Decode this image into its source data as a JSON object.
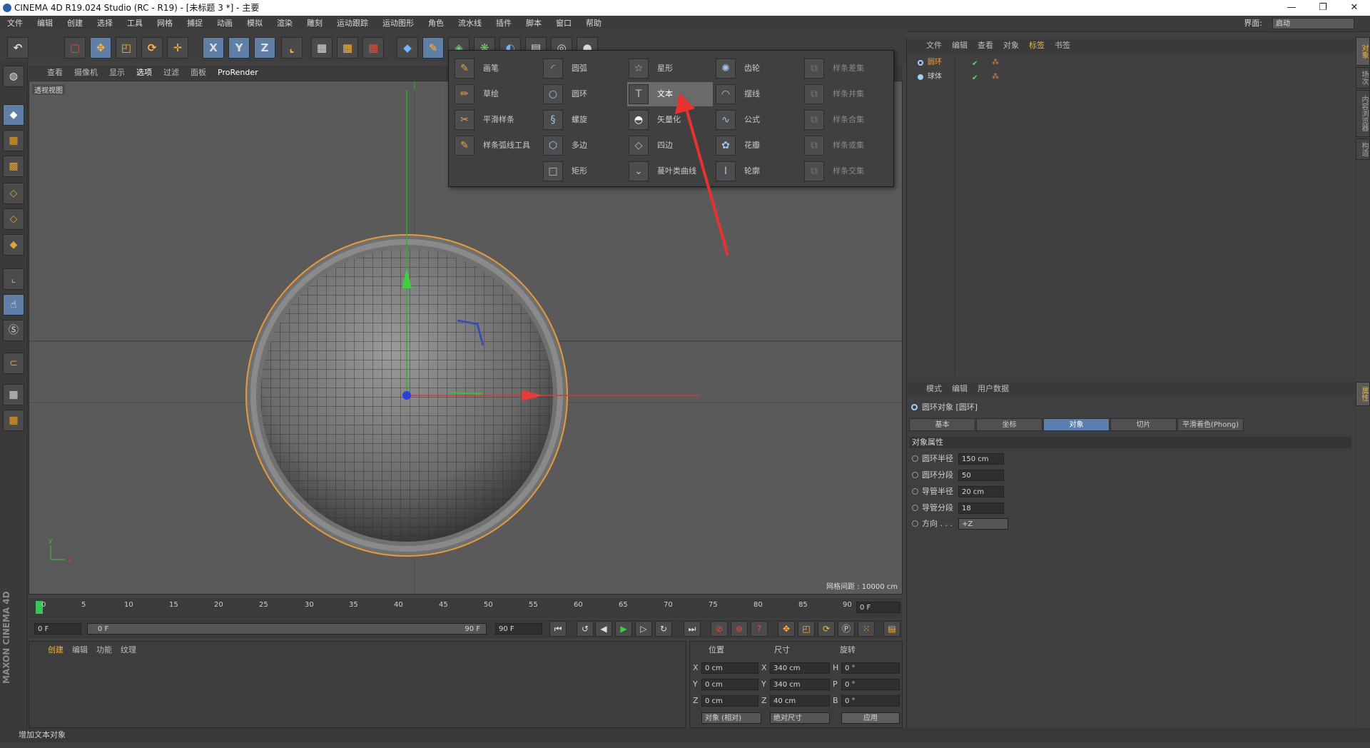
{
  "window": {
    "title": "CINEMA 4D R19.024 Studio (RC - R19) - [未标题 3 *] - 主要",
    "controls": [
      "—",
      "❐",
      "✕"
    ]
  },
  "menubar": {
    "items": [
      "文件",
      "编辑",
      "创建",
      "选择",
      "工具",
      "网格",
      "捕捉",
      "动画",
      "模拟",
      "渲染",
      "雕刻",
      "运动跟踪",
      "运动图形",
      "角色",
      "流水线",
      "插件",
      "脚本",
      "窗口",
      "帮助"
    ],
    "layout_label": "界面:",
    "layout_value": "启动"
  },
  "toolbar": {
    "axis_x": "X",
    "axis_y": "Y",
    "axis_z": "Z"
  },
  "viewport": {
    "menu": [
      "查看",
      "摄像机",
      "显示",
      "选项",
      "过滤",
      "面板",
      "ProRender"
    ],
    "label": "透视视图",
    "grid_spacing": "网格间距 : 10000 cm"
  },
  "spline_menu": {
    "col1": [
      "画笔",
      "草绘",
      "平滑样条",
      "样条弧线工具"
    ],
    "col2": [
      "圆弧",
      "圆环",
      "螺旋",
      "多边",
      "矩形"
    ],
    "col3": [
      "星形",
      "文本",
      "矢量化",
      "四边",
      "蔓叶类曲线"
    ],
    "col4": [
      "齿轮",
      "摆线",
      "公式",
      "花瓣",
      "轮廓"
    ],
    "col5": [
      "样条差集",
      "样条并集",
      "样条合集",
      "样条或集",
      "样条交集"
    ]
  },
  "object_manager": {
    "menu": [
      "文件",
      "编辑",
      "查看",
      "对象",
      "标签",
      "书签"
    ],
    "objects": [
      {
        "name": "圆环"
      },
      {
        "name": "球体"
      }
    ]
  },
  "attributes": {
    "menu": [
      "模式",
      "编辑",
      "用户数据"
    ],
    "title": "圆环对象 [圆环]",
    "tabs": [
      "基本",
      "坐标",
      "对象",
      "切片",
      "平滑着色(Phong)"
    ],
    "active_tab": "对象",
    "section": "对象属性",
    "props": [
      {
        "label": "圆环半径",
        "value": "150 cm"
      },
      {
        "label": "圆环分段",
        "value": "50"
      },
      {
        "label": "导管半径",
        "value": "20 cm"
      },
      {
        "label": "导管分段",
        "value": "18"
      },
      {
        "label": "方向 . . .",
        "value": "+Z"
      }
    ]
  },
  "right_vtabs": [
    "对象",
    "场次",
    "内容浏览器",
    "构造",
    "属性"
  ],
  "timeline": {
    "ticks": [
      "0",
      "5",
      "10",
      "15",
      "20",
      "25",
      "30",
      "35",
      "40",
      "45",
      "50",
      "55",
      "60",
      "65",
      "70",
      "75",
      "80",
      "85",
      "90"
    ],
    "current_frame": "0 F",
    "start": "0 F",
    "range_start": "0 F",
    "range_end": "90 F",
    "end": "90 F"
  },
  "material_manager": {
    "menu": [
      "创建",
      "编辑",
      "功能",
      "纹理"
    ]
  },
  "coordinates": {
    "headers": [
      "位置",
      "尺寸",
      "旋转"
    ],
    "rows": [
      {
        "axis": "X",
        "pos": "0 cm",
        "size_axis": "X",
        "size": "340 cm",
        "rot_axis": "H",
        "rot": "0 °"
      },
      {
        "axis": "Y",
        "pos": "0 cm",
        "size_axis": "Y",
        "size": "340 cm",
        "rot_axis": "P",
        "rot": "0 °"
      },
      {
        "axis": "Z",
        "pos": "0 cm",
        "size_axis": "Z",
        "size": "40 cm",
        "rot_axis": "B",
        "rot": "0 °"
      }
    ],
    "mode": "对象 (相对)",
    "size_mode": "绝对尺寸",
    "apply": "应用"
  },
  "status": "增加文本对象",
  "brand": "MAXON CINEMA 4D"
}
